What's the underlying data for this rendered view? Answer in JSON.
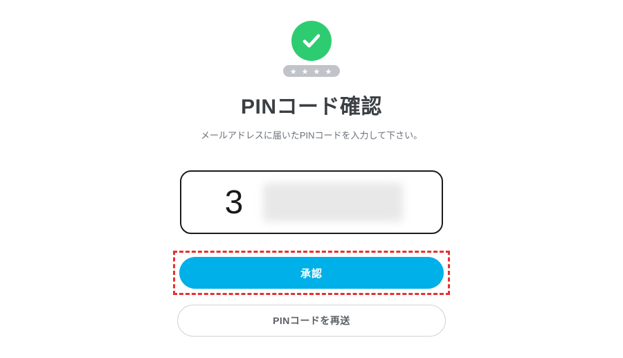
{
  "icon": {
    "check": "check-icon",
    "stars": "★ ★ ★ ★"
  },
  "heading": {
    "title": "PINコード確認",
    "subtitle": "メールアドレスに届いたPINコードを入力して下さい。"
  },
  "pin": {
    "digit1": "3"
  },
  "buttons": {
    "primary": "承認",
    "secondary": "PINコードを再送"
  },
  "colors": {
    "accent": "#00b0e8",
    "success": "#2ecc71",
    "highlight": "#e63030"
  }
}
